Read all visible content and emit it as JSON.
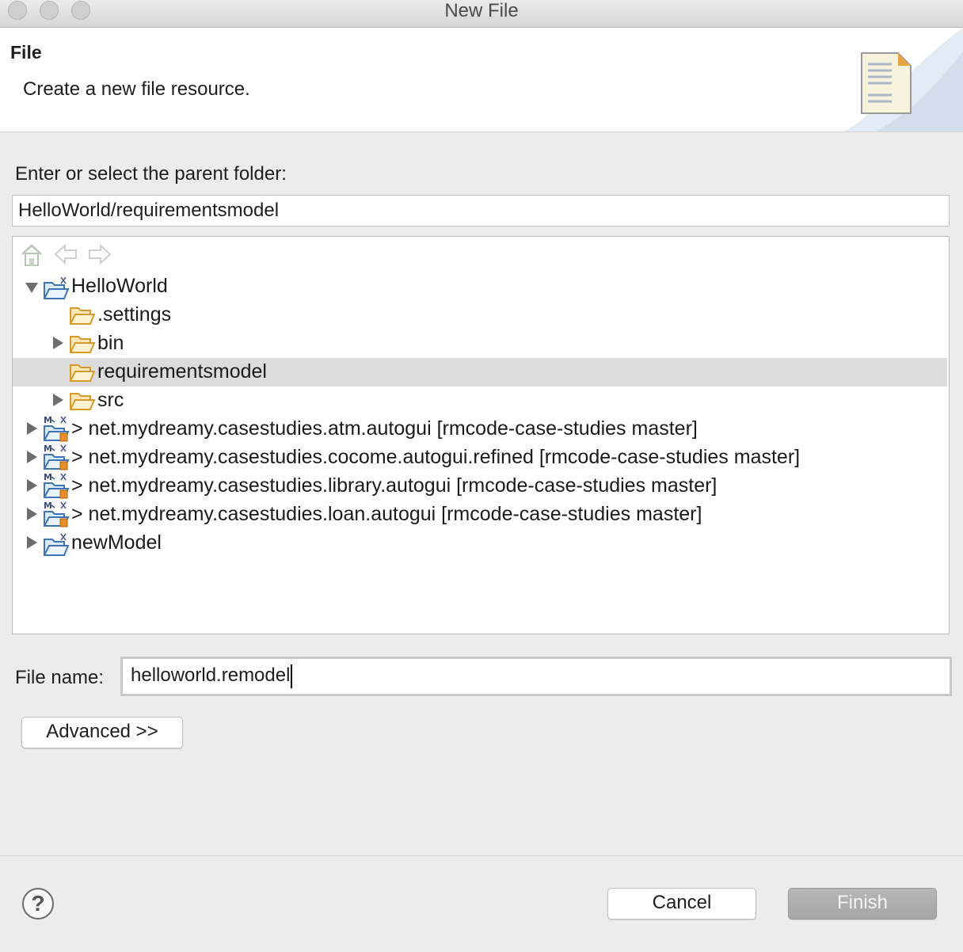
{
  "window": {
    "title": "New File",
    "controls": [
      "close",
      "minimize",
      "zoom"
    ]
  },
  "banner": {
    "title": "File",
    "description": "Create a new file resource."
  },
  "parent_folder": {
    "label": "Enter or select the parent folder:",
    "value": "HelloWorld/requirementsmodel"
  },
  "tree": {
    "toolbar": [
      "home-icon",
      "back-arrow-icon",
      "forward-arrow-icon"
    ],
    "items": [
      {
        "label": "HelloWorld",
        "expander": "expanded",
        "icon": "project-folder-icon",
        "depth": 0,
        "selected": false
      },
      {
        "label": ".settings",
        "expander": "none",
        "icon": "folder-icon",
        "depth": 1,
        "selected": false
      },
      {
        "label": "bin",
        "expander": "collapsed",
        "icon": "folder-icon",
        "depth": 1,
        "selected": false
      },
      {
        "label": "requirementsmodel",
        "expander": "none",
        "icon": "folder-icon",
        "depth": 1,
        "selected": true
      },
      {
        "label": "src",
        "expander": "collapsed",
        "icon": "folder-icon",
        "depth": 1,
        "selected": false
      },
      {
        "label": "> net.mydreamy.casestudies.atm.autogui [rmcode-case-studies master]",
        "expander": "collapsed",
        "icon": "git-java-project-icon",
        "depth": 0,
        "selected": false
      },
      {
        "label": "> net.mydreamy.casestudies.cocome.autogui.refined [rmcode-case-studies master]",
        "expander": "collapsed",
        "icon": "git-java-project-icon",
        "depth": 0,
        "selected": false
      },
      {
        "label": "> net.mydreamy.casestudies.library.autogui [rmcode-case-studies master]",
        "expander": "collapsed",
        "icon": "git-java-project-icon",
        "depth": 0,
        "selected": false
      },
      {
        "label": "> net.mydreamy.casestudies.loan.autogui [rmcode-case-studies master]",
        "expander": "collapsed",
        "icon": "git-java-project-icon",
        "depth": 0,
        "selected": false
      },
      {
        "label": "newModel",
        "expander": "collapsed",
        "icon": "project-folder-icon",
        "depth": 0,
        "selected": false
      }
    ]
  },
  "file_name": {
    "label": "File name:",
    "value": "helloworld.remodel"
  },
  "buttons": {
    "advanced": "Advanced >>",
    "cancel": "Cancel",
    "finish": "Finish",
    "help": "?"
  },
  "colors": {
    "selection": "#dcdcdc",
    "folder": "#d79a2b",
    "finish_disabled": "#aaaaaa"
  }
}
